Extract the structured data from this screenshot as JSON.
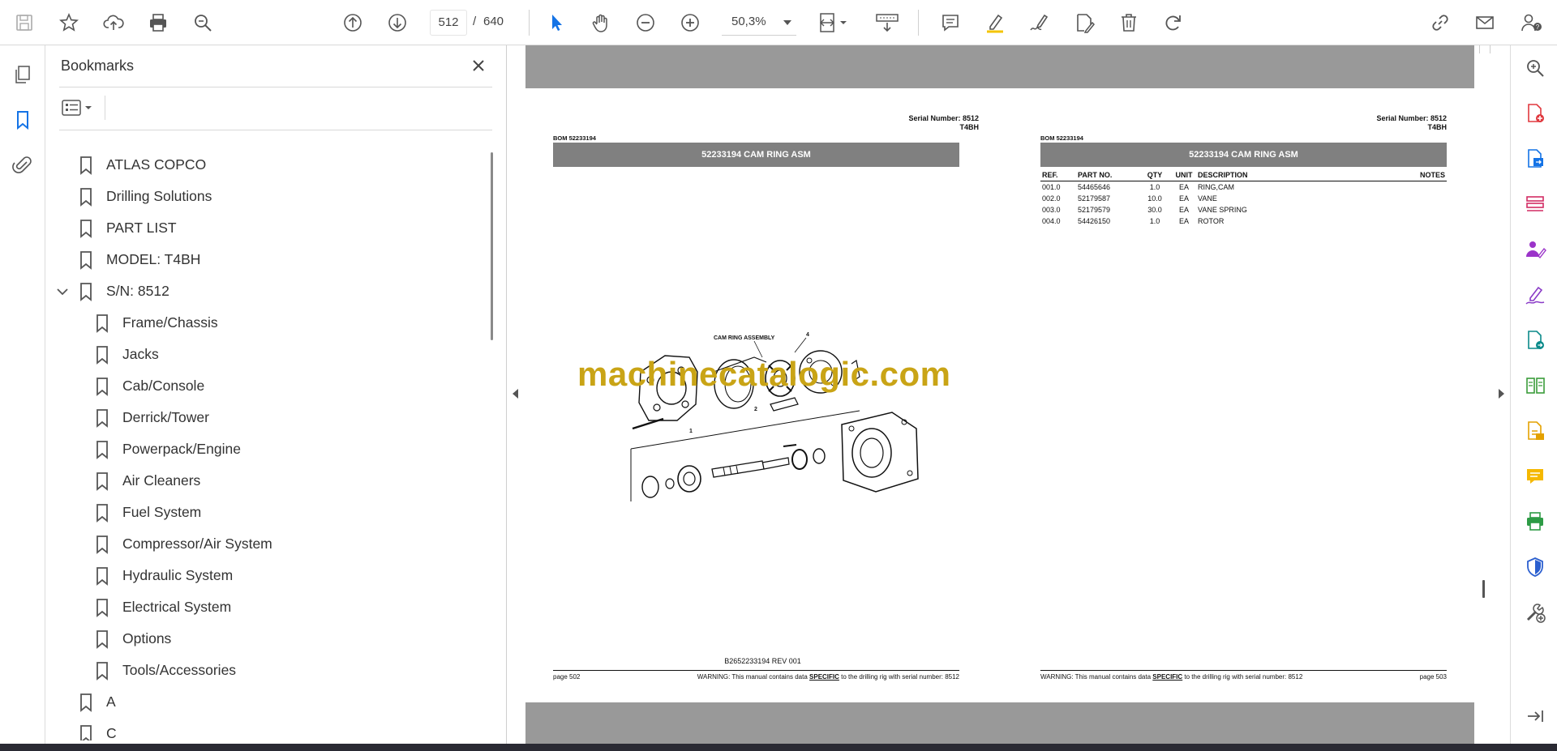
{
  "toolbar": {
    "page_current": "512",
    "page_separator": "/",
    "page_total": "640",
    "zoom": "50,3%"
  },
  "bookmarks": {
    "title": "Bookmarks",
    "items": [
      {
        "label": "ATLAS COPCO"
      },
      {
        "label": "Drilling Solutions"
      },
      {
        "label": "PART LIST"
      },
      {
        "label": "MODEL: T4BH"
      },
      {
        "label": "S/N: 8512"
      },
      {
        "label": "Frame/Chassis"
      },
      {
        "label": "Jacks"
      },
      {
        "label": "Cab/Console"
      },
      {
        "label": "Derrick/Tower"
      },
      {
        "label": "Powerpack/Engine"
      },
      {
        "label": "Air Cleaners"
      },
      {
        "label": "Fuel System"
      },
      {
        "label": "Compressor/Air System"
      },
      {
        "label": "Hydraulic System"
      },
      {
        "label": "Electrical System"
      },
      {
        "label": "Options"
      },
      {
        "label": "Tools/Accessories"
      },
      {
        "label": "A"
      },
      {
        "label": "C"
      }
    ]
  },
  "left_page": {
    "serial_line1": "Serial Number: 8512",
    "serial_line2": "T4BH",
    "bom": "BOM 52233194",
    "title": "52233194 CAM RING ASM",
    "drawing_label_assembly": "CAM RING ASSEMBLY",
    "drawing_callout_1": "1",
    "drawing_callout_2": "2",
    "drawing_callout_4": "4",
    "drawing_ref": "B2652233194 REV 001",
    "footer_page": "page 502",
    "footer_warn_pre": "WARNING:  This manual contains data ",
    "footer_warn_em": "SPECIFIC",
    "footer_warn_post": " to the drilling rig with serial number: 8512"
  },
  "right_page": {
    "serial_line1": "Serial Number: 8512",
    "serial_line2": "T4BH",
    "bom": "BOM 52233194",
    "title": "52233194 CAM RING ASM",
    "table_headers": {
      "ref": "REF.",
      "part": "PART NO.",
      "qty": "QTY",
      "unit": "UNIT",
      "desc": "DESCRIPTION",
      "notes": "NOTES"
    },
    "rows": [
      {
        "ref": "001.0",
        "part": "54465646",
        "qty": "1.0",
        "unit": "EA",
        "desc": "RING,CAM"
      },
      {
        "ref": "002.0",
        "part": "52179587",
        "qty": "10.0",
        "unit": "EA",
        "desc": "VANE"
      },
      {
        "ref": "003.0",
        "part": "52179579",
        "qty": "30.0",
        "unit": "EA",
        "desc": "VANE SPRING"
      },
      {
        "ref": "004.0",
        "part": "54426150",
        "qty": "1.0",
        "unit": "EA",
        "desc": "ROTOR"
      }
    ],
    "footer_warn_pre": "WARNING:  This manual contains data ",
    "footer_warn_em": "SPECIFIC",
    "footer_warn_post": " to the drilling rig with serial number: 8512",
    "footer_page": "page 503"
  },
  "watermark": "machinecatalogic.com",
  "colors": {
    "accent_blue": "#1473e6",
    "watermark": "#c9a416",
    "title_bar": "#808080",
    "page_gray": "#999999"
  }
}
